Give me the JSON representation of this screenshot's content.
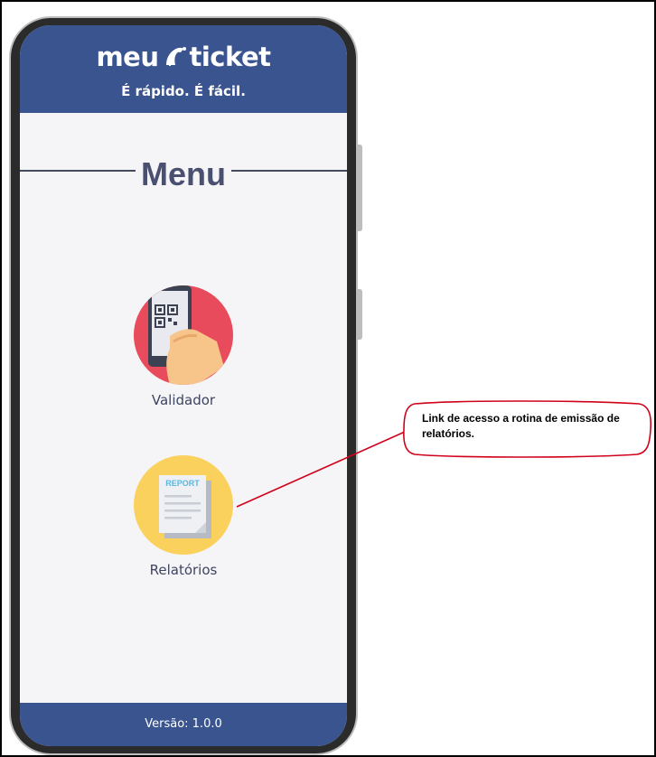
{
  "app": {
    "logo_left": "meu",
    "logo_right": "ticket",
    "tagline": "É rápido. É fácil."
  },
  "menu": {
    "title": "Menu",
    "items": [
      {
        "label": "Validador",
        "icon": "qr-scan-icon",
        "color": "#e74b5c"
      },
      {
        "label": "Relatórios",
        "icon": "report-icon",
        "color": "#fbd15d",
        "icon_text": "REPORT"
      }
    ]
  },
  "footer": {
    "version": "Versão: 1.0.0"
  },
  "callout": {
    "text": "Link de acesso a rotina de emissão de relatórios."
  },
  "colors": {
    "brand": "#3a5490",
    "annotation": "#d0021b"
  }
}
